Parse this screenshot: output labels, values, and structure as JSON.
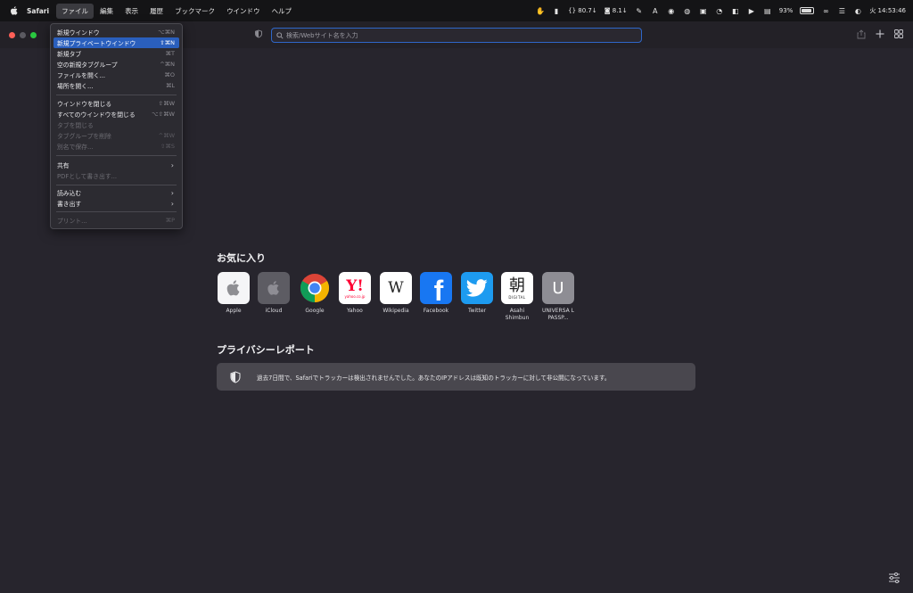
{
  "menubar": {
    "app_name": "Safari",
    "menus": [
      "ファイル",
      "編集",
      "表示",
      "履歴",
      "ブックマーク",
      "ウインドウ",
      "ヘルプ"
    ],
    "status": {
      "net_speed_1": "80.7",
      "net_speed_2": "8.1",
      "battery": "93%",
      "clock": "火 14:53:46"
    }
  },
  "toolbar": {
    "search_placeholder": "検索/Webサイト名を入力"
  },
  "file_menu": {
    "items": [
      {
        "label": "新規ウインドウ",
        "shortcut": "⌥⌘N"
      },
      {
        "label": "新規プライベートウインドウ",
        "shortcut": "⇧⌘N"
      },
      {
        "label": "新規タブ",
        "shortcut": "⌘T"
      },
      {
        "label": "空の新規タブグループ",
        "shortcut": "^⌘N"
      },
      {
        "label": "ファイルを開く...",
        "shortcut": "⌘O"
      },
      {
        "label": "場所を開く...",
        "shortcut": "⌘L"
      },
      {
        "label": "ウインドウを閉じる",
        "shortcut": "⇧⌘W"
      },
      {
        "label": "すべてのウインドウを閉じる",
        "shortcut": "⌥⇧⌘W"
      },
      {
        "label": "タブを閉じる",
        "shortcut": ""
      },
      {
        "label": "タブグループを削除",
        "shortcut": "^⌘W"
      },
      {
        "label": "別名で保存...",
        "shortcut": "⇧⌘S"
      },
      {
        "label": "共有",
        "shortcut": ""
      },
      {
        "label": "PDFとして書き出す...",
        "shortcut": ""
      },
      {
        "label": "読み込む",
        "shortcut": ""
      },
      {
        "label": "書き出す",
        "shortcut": ""
      },
      {
        "label": "プリント...",
        "shortcut": "⌘P"
      }
    ]
  },
  "favorites": {
    "title": "お気に入り",
    "items": [
      {
        "name": "Apple"
      },
      {
        "name": "iCloud"
      },
      {
        "name": "Google"
      },
      {
        "name": "Yahoo",
        "tile_text": "Y!",
        "tile_sub": "yahoo.co.jp"
      },
      {
        "name": "Wikipedia",
        "tile_text": "W"
      },
      {
        "name": "Facebook",
        "tile_text": "f"
      },
      {
        "name": "Twitter"
      },
      {
        "name": "Asahi Shimbun",
        "tile_text": "朝",
        "tile_sub": "DIGITAL"
      },
      {
        "name": "UNIVERSA L PASSP...",
        "tile_text": "U"
      }
    ]
  },
  "privacy": {
    "title": "プライバシーレポート",
    "message": "過去7日間で、Safariでトラッカーは検出されませんでした。あなたのIPアドレスは既知のトラッカーに対して非公開になっています。"
  },
  "colors": {
    "accent": "#2a5fbd",
    "background": "#27252d",
    "close": "#fe5f57",
    "minimize": "#5b5a61",
    "zoom": "#2ac840"
  }
}
